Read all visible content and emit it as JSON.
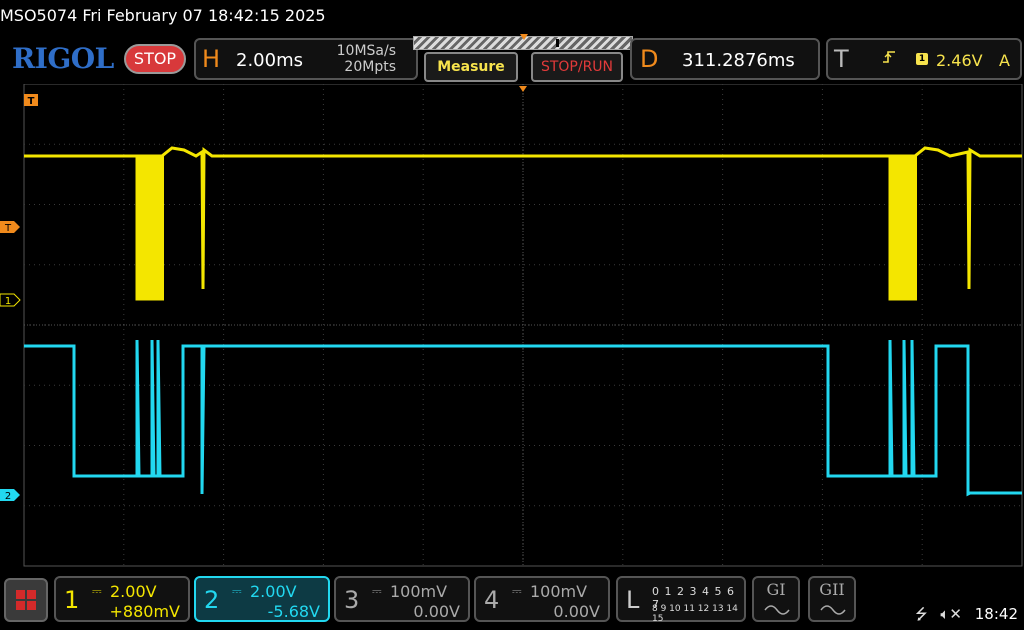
{
  "title": "MSO5074  Fri February 07 18:42:15 2025",
  "header": {
    "logo": "RIGOL",
    "run_state": "STOP",
    "horizontal": {
      "letter": "H",
      "timebase": "2.00ms",
      "sample_rate": "10MSa/s",
      "memory_depth": "20Mpts"
    },
    "measure_label": "Measure",
    "stoprun_label": "STOP/RUN",
    "delay": {
      "letter": "D",
      "value": "311.2876ms"
    },
    "trigger": {
      "letter": "T",
      "edge_icon": "rising-edge-icon",
      "source": "1",
      "level": "2.46V",
      "mode": "A"
    }
  },
  "markers": {
    "trigger_top": "T",
    "trigger_level": "T",
    "ch1": "1",
    "ch2": "2"
  },
  "colors": {
    "ch1": "#f4e600",
    "ch2": "#22d8f0",
    "ch3": "#aaaaaa",
    "ch4": "#aaaaaa",
    "trigger": "#f08a1c",
    "logo": "#2f6ec8",
    "stop_badge": "#d8393b"
  },
  "channels": [
    {
      "number": "1",
      "coupling_icon": "dc-coupling-icon",
      "scale": "2.00V",
      "offset": "+880mV",
      "color": "#f4e600",
      "active": false
    },
    {
      "number": "2",
      "coupling_icon": "dc-coupling-icon",
      "scale": "2.00V",
      "offset": "-5.68V",
      "color": "#22d8f0",
      "active": true
    },
    {
      "number": "3",
      "coupling_icon": "dc-coupling-icon",
      "scale": "100mV",
      "offset": "0.00V",
      "color": "#aaaaaa",
      "active": false
    },
    {
      "number": "4",
      "coupling_icon": "dc-coupling-icon",
      "scale": "100mV",
      "offset": "0.00V",
      "color": "#aaaaaa",
      "active": false
    }
  ],
  "logic": {
    "letter": "L",
    "row1": "0 1 2 3  4 5 6 7",
    "row2": "8 9 10 11  12 13 14 15"
  },
  "generators": {
    "g1": "GI",
    "g2": "GII"
  },
  "status": {
    "usb_icon": "usb-icon",
    "speaker_icon": "speaker-muted-icon",
    "time": "18:42"
  }
}
